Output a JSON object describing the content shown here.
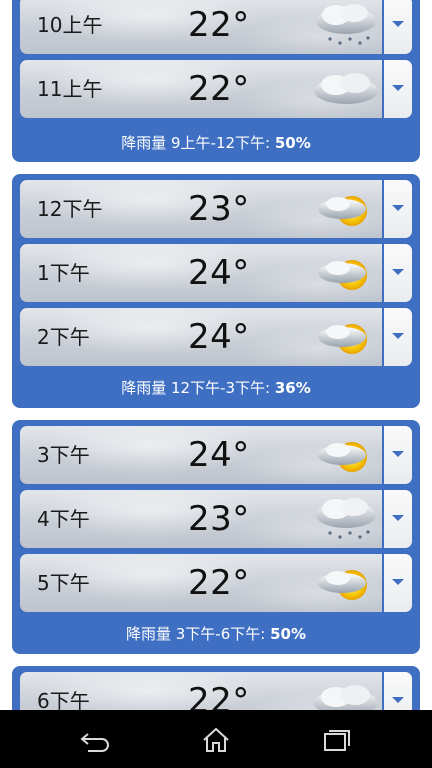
{
  "groups": [
    {
      "rows": [
        {
          "time": "10上午",
          "temp": "22°",
          "icon": "cloud-rain-icon"
        },
        {
          "time": "11上午",
          "temp": "22°",
          "icon": "cloud-icon"
        }
      ],
      "precip_label": "降雨量 9上午-12下午: ",
      "precip_value": "50%"
    },
    {
      "rows": [
        {
          "time": "12下午",
          "temp": "23°",
          "icon": "partly-sunny-icon"
        },
        {
          "time": "1下午",
          "temp": "24°",
          "icon": "partly-sunny-icon"
        },
        {
          "time": "2下午",
          "temp": "24°",
          "icon": "partly-sunny-icon"
        }
      ],
      "precip_label": "降雨量 12下午-3下午: ",
      "precip_value": "36%"
    },
    {
      "rows": [
        {
          "time": "3下午",
          "temp": "24°",
          "icon": "partly-sunny-icon"
        },
        {
          "time": "4下午",
          "temp": "23°",
          "icon": "cloud-rain-icon"
        },
        {
          "time": "5下午",
          "temp": "22°",
          "icon": "partly-sunny-icon"
        }
      ],
      "precip_label": "降雨量 3下午-6下午: ",
      "precip_value": "50%"
    },
    {
      "rows": [
        {
          "time": "6下午",
          "temp": "22°",
          "icon": "cloud-icon"
        }
      ]
    }
  ],
  "navbar": {
    "back_icon": "back-icon",
    "home_icon": "home-icon",
    "recents_icon": "recent-apps-icon"
  },
  "colors": {
    "group_background": "#3f6fc2",
    "navbar_background": "#000000"
  }
}
